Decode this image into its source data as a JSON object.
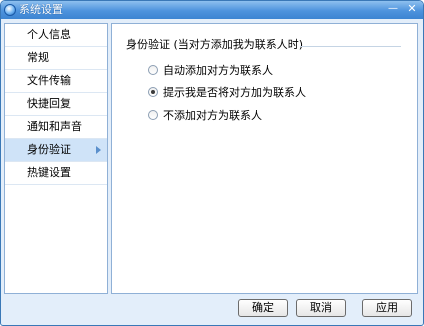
{
  "window": {
    "title": "系统设置",
    "minimize_symbol": "—",
    "close_symbol": "✕"
  },
  "sidebar": {
    "items": [
      {
        "label": "个人信息"
      },
      {
        "label": "常规"
      },
      {
        "label": "文件传输"
      },
      {
        "label": "快捷回复"
      },
      {
        "label": "通知和声音"
      },
      {
        "label": "身份验证",
        "selected": true
      },
      {
        "label": "热键设置"
      }
    ]
  },
  "auth": {
    "title": "身份验证 (当对方添加我为联系人时)",
    "options": [
      {
        "label": "自动添加对方为联系人",
        "checked": false
      },
      {
        "label": "提示我是否将对方加为联系人",
        "checked": true
      },
      {
        "label": "不添加对方为联系人",
        "checked": false
      }
    ]
  },
  "buttons": {
    "ok": "确定",
    "cancel": "取消",
    "apply": "应用"
  },
  "colors": {
    "titlebar": "#4d93dd",
    "window_bg": "#e3eefa",
    "selected_item": "#cfe3f8"
  }
}
